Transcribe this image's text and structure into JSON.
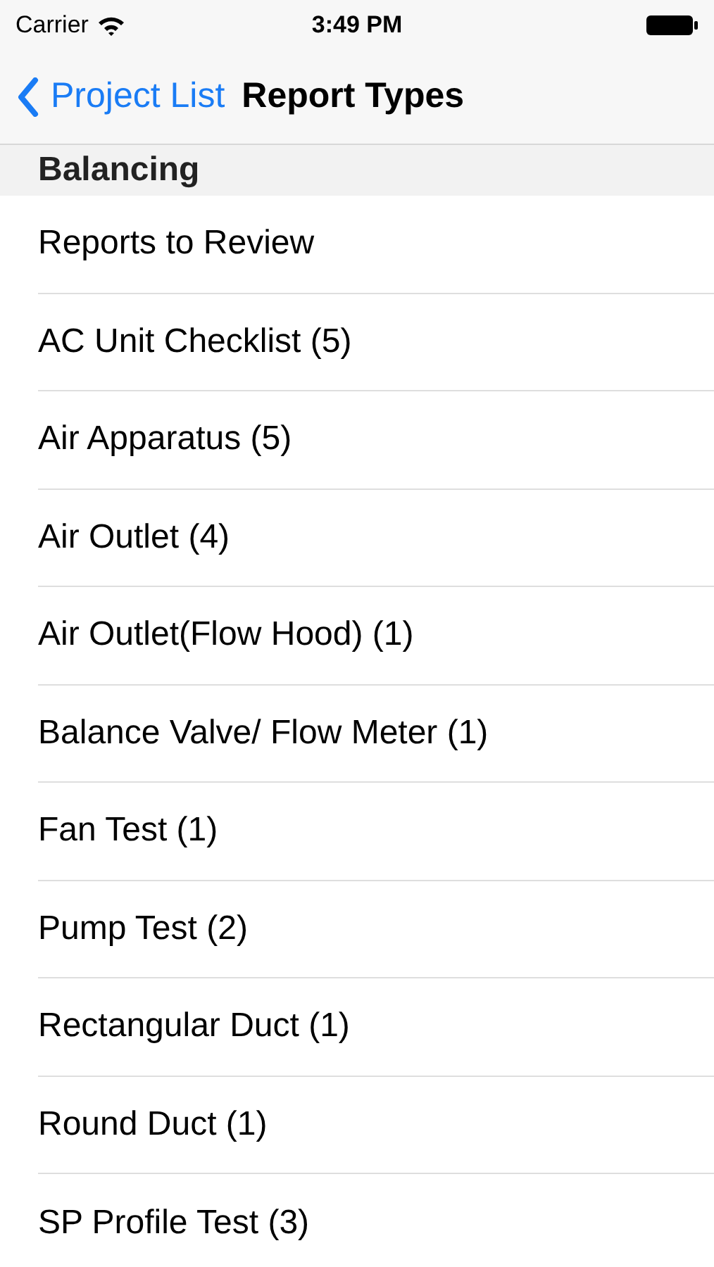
{
  "status_bar": {
    "carrier": "Carrier",
    "time": "3:49 PM"
  },
  "nav_bar": {
    "back_label": "Project List",
    "title": "Report Types"
  },
  "section": {
    "header": "Balancing",
    "rows": [
      {
        "label": "Reports to Review"
      },
      {
        "label": "AC Unit Checklist (5)"
      },
      {
        "label": "Air Apparatus (5)"
      },
      {
        "label": "Air Outlet (4)"
      },
      {
        "label": "Air Outlet(Flow Hood) (1)"
      },
      {
        "label": "Balance Valve/ Flow Meter (1)"
      },
      {
        "label": "Fan Test (1)"
      },
      {
        "label": "Pump Test (2)"
      },
      {
        "label": "Rectangular Duct (1)"
      },
      {
        "label": "Round Duct (1)"
      },
      {
        "label": "SP Profile Test (3)"
      }
    ]
  }
}
